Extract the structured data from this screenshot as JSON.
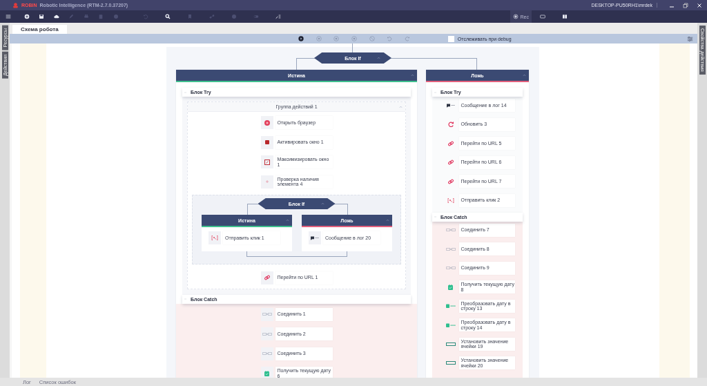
{
  "window": {
    "app_name": "ROBIN",
    "title": "Robotic Intelligence (RTM-2.7.0.37207)",
    "user": "DESKTOP-PU50RH1\\mrdek"
  },
  "toolbar": {
    "left": [
      {
        "disabled": false
      },
      {
        "disabled": false
      },
      {
        "disabled": false
      },
      {
        "disabled": true
      },
      {
        "disabled": true
      },
      {
        "disabled": true
      },
      {
        "disabled": true
      }
    ],
    "middle": [
      {
        "disabled": true
      },
      {
        "disabled": false
      },
      {
        "disabled": true
      },
      {
        "disabled": true
      },
      {
        "disabled": true
      },
      {
        "disabled": true
      },
      {
        "disabled": false
      }
    ],
    "rec_label": "Rec"
  },
  "side_tabs": {
    "left": [
      "Ресурсы",
      "Действия"
    ],
    "right": [
      "Свойства действия"
    ]
  },
  "tabs": [
    {
      "label": "Схема робота",
      "selected": true
    }
  ],
  "canvas_toolbar": {
    "buttons": [
      {
        "disabled": false
      },
      {
        "disabled": true
      },
      {
        "disabled": true
      },
      {
        "disabled": true
      },
      {
        "disabled": true
      },
      {
        "disabled": true
      },
      {
        "disabled": true
      }
    ],
    "debug_label": "Отслеживать при debug",
    "debug_checked": false
  },
  "diagram": {
    "label": "Блок If",
    "branches": [
      {
        "label": "Истина",
        "kind": "true",
        "try": {
          "label": "Блок Try",
          "items": [
            {
              "kind": "group",
              "label": "Группа действий 1",
              "children": [
                {
                  "kind": "browser",
                  "title": "Открыть браузер"
                },
                {
                  "kind": "window",
                  "title": "Активировать окно 1"
                },
                {
                  "kind": "maximize",
                  "title": "Максимизировать окно 1"
                },
                {
                  "kind": "check",
                  "title": "Проверка наличия элемента 4"
                },
                {
                  "kind": "if",
                  "label": "Блок If",
                  "branches": [
                    {
                      "label": "Истина",
                      "kind": "true",
                      "items": [
                        {
                          "kind": "click",
                          "title": "Отправить клик 1"
                        }
                      ]
                    },
                    {
                      "label": "Ложь",
                      "kind": "false",
                      "items": [
                        {
                          "kind": "log",
                          "title": "Сообщение в лог 20"
                        }
                      ]
                    }
                  ]
                },
                {
                  "kind": "url",
                  "title": "Перейти по URL 1"
                }
              ]
            }
          ]
        },
        "catch": {
          "label": "Блок Catch",
          "items": [
            {
              "kind": "join",
              "title": "Соединить 1"
            },
            {
              "kind": "join",
              "title": "Соединить 2"
            },
            {
              "kind": "join",
              "title": "Соединить 3"
            },
            {
              "kind": "date",
              "title": "Получить текущую дату 6"
            }
          ]
        }
      },
      {
        "label": "Ложь",
        "kind": "false",
        "try": {
          "label": "Блок Try",
          "items": [
            {
              "kind": "log",
              "title": "Сообщение в лог 14"
            },
            {
              "kind": "refresh",
              "title": "Обновить 3"
            },
            {
              "kind": "url",
              "title": "Перейти по URL 5"
            },
            {
              "kind": "url",
              "title": "Перейти по URL 6"
            },
            {
              "kind": "url",
              "title": "Перейти по URL 7"
            },
            {
              "kind": "click",
              "title": "Отправить клик 2"
            }
          ]
        },
        "catch": {
          "label": "Блок Catch",
          "items": [
            {
              "kind": "join",
              "title": "Соединить 7"
            },
            {
              "kind": "join",
              "title": "Соединить 8"
            },
            {
              "kind": "join",
              "title": "Соединить 9"
            },
            {
              "kind": "date",
              "title": "Получить текущую дату 8"
            },
            {
              "kind": "datestr",
              "title": "Преобразовать дату в строку 13"
            },
            {
              "kind": "datestr",
              "title": "Преобразовать дату в строку 14"
            },
            {
              "kind": "cell",
              "title": "Установить значение ячейки 19"
            },
            {
              "kind": "cell",
              "title": "Установить значение ячейки 20"
            }
          ]
        }
      }
    ]
  },
  "bottom_tabs": [
    {
      "label": "Лог",
      "selected": false
    },
    {
      "label": "Список ошибок",
      "selected": false
    }
  ]
}
